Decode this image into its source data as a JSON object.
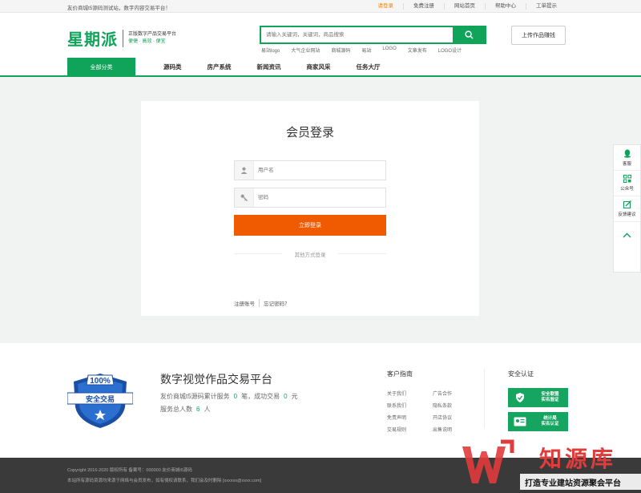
{
  "topbar": {
    "welcome": "友价商城t5源码测试站，数字内容交易平台！",
    "links": [
      "请登录",
      "免费注册",
      "网站首页",
      "帮助中心",
      "工单提示"
    ]
  },
  "header": {
    "logo": "星期派",
    "logo_sub": "正版数字产品交易平台",
    "logo_slogan": "便捷 · 高效 · 便宜",
    "search_placeholder": "请输入关键词，关键词，商品搜索",
    "hot_words": [
      "易站logo",
      "大气企业网站",
      "商城源码",
      "易站",
      "LOGO",
      "文章发布",
      "LOGO设计"
    ],
    "upload_label": "上传作品赚钱"
  },
  "nav": {
    "all_label": "全部分类",
    "items": [
      "源码类",
      "房产系统",
      "新闻资讯",
      "商家风采",
      "任务大厅"
    ]
  },
  "login": {
    "title": "会员登录",
    "username_placeholder": "用户名",
    "password_placeholder": "密码",
    "submit_label": "立即登录",
    "other_label": "其他方式登录",
    "register_label": "注册账号",
    "forgot_label": "忘记密码？"
  },
  "side": {
    "items": [
      {
        "label": "客服",
        "icon": "qq-icon"
      },
      {
        "label": "公众号",
        "icon": "qrcode-icon"
      },
      {
        "label": "反馈建议",
        "icon": "edit-icon"
      }
    ]
  },
  "footer": {
    "badge_pct": "100%",
    "badge_text": "安全交易",
    "title": "数字视觉作品交易平台",
    "stat_prefix": "友价商城t5源码累计服务",
    "stat_orders": "0",
    "stat_mid": "笔，成功交易",
    "stat_success": "0",
    "stat_unit": "元",
    "users_prefix": "服务总人数",
    "users_count": "6",
    "users_unit": "人",
    "guide_title": "客户指南",
    "guide_links": [
      "关于我们",
      "广告合作",
      "联系我们",
      "隐私条款",
      "免责声明",
      "开店协议",
      "交易规则",
      "出售说明"
    ],
    "security_title": "安全认证",
    "cert1": [
      "安全联盟",
      "实名验证"
    ],
    "cert2": [
      "统计局",
      "实名认证"
    ]
  },
  "copyright": {
    "line1": "Copyright 2016-2020 版权所有 备案号：000000 友价商城t5源码",
    "line2": "本站所有源码资源均来源于网络与会员发布，如有侵权请联系，我们会及时删除 [xxxxxx@xxxx.com]"
  },
  "watermark": {
    "brand": "知源库",
    "tagline": "打造专业建站资源聚会平台"
  },
  "colors": {
    "brand_green": "#10a35a",
    "login_orange": "#f05a00",
    "accent_orange": "#f08300",
    "watermark_red": "#e23b3b"
  }
}
